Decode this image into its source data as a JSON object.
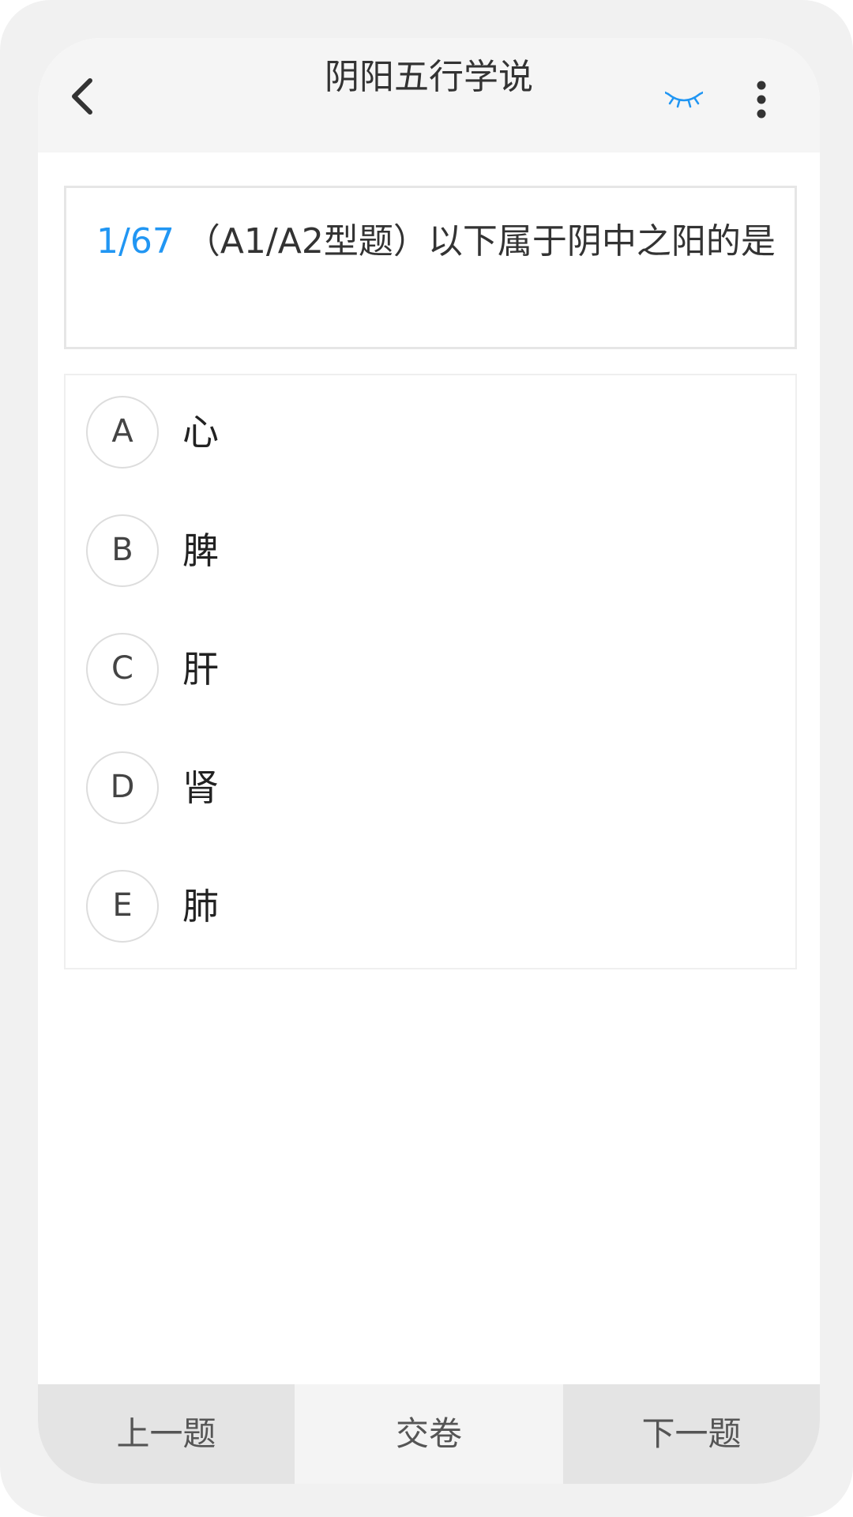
{
  "header": {
    "title": "阴阳五行学说",
    "back_icon": "chevron-left-icon",
    "eye_icon": "eye-closed-icon",
    "more_icon": "more-vertical-icon",
    "accent_color": "#2196f3"
  },
  "question": {
    "number": "1/67",
    "text": "（A1/A2型题）以下属于阴中之阳的是"
  },
  "options": [
    {
      "letter": "A",
      "text": "心"
    },
    {
      "letter": "B",
      "text": "脾"
    },
    {
      "letter": "C",
      "text": "肝"
    },
    {
      "letter": "D",
      "text": "肾"
    },
    {
      "letter": "E",
      "text": "肺"
    }
  ],
  "footer": {
    "prev_label": "上一题",
    "submit_label": "交卷",
    "next_label": "下一题"
  }
}
